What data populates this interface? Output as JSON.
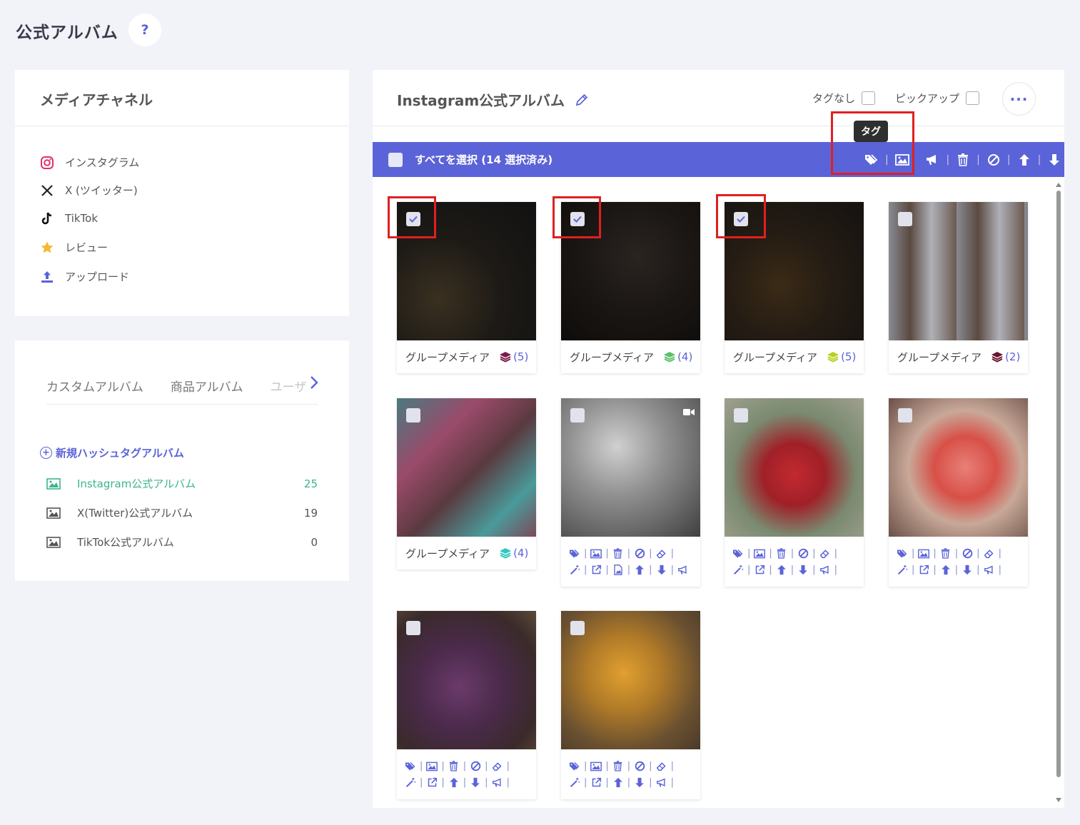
{
  "page": {
    "title": "公式アルバム",
    "help_label": "?"
  },
  "channels": {
    "title": "メディアチャネル",
    "items": [
      {
        "label": "インスタグラム",
        "icon": "instagram-icon"
      },
      {
        "label": "X (ツイッター)",
        "icon": "x-icon"
      },
      {
        "label": "TikTok",
        "icon": "tiktok-icon"
      },
      {
        "label": "レビュー",
        "icon": "star-icon"
      },
      {
        "label": "アップロード",
        "icon": "upload-icon"
      }
    ]
  },
  "albums": {
    "tabs": [
      "カスタムアルバム",
      "商品アルバム",
      "ユーザ"
    ],
    "new_album_label": "新規ハッシュタグアルバム",
    "items": [
      {
        "name": "Instagram公式アルバム",
        "count": "25",
        "active": true
      },
      {
        "name": "X(Twitter)公式アルバム",
        "count": "19",
        "active": false
      },
      {
        "name": "TikTok公式アルバム",
        "count": "0",
        "active": false
      }
    ]
  },
  "main": {
    "title": "Instagram公式アルバム",
    "filter_no_tag": "タグなし",
    "filter_pickup": "ピックアップ",
    "more_label": "···",
    "select_all_label": "すべてを選択 (14 選択済み)",
    "tooltip": "タグ"
  },
  "media": [
    {
      "checked": true,
      "caption": "グループメディア",
      "count": "(5)",
      "layer_color": "#7a1a4a",
      "video": false
    },
    {
      "checked": true,
      "caption": "グループメディア",
      "count": "(4)",
      "layer_color": "#5cbf6a",
      "video": false
    },
    {
      "checked": true,
      "caption": "グループメディア",
      "count": "(5)",
      "layer_color": "#b8d020",
      "video": false
    },
    {
      "checked": false,
      "caption": "グループメディア",
      "count": "(2)",
      "layer_color": "#6a1530",
      "video": false
    },
    {
      "checked": false,
      "caption": "グループメディア",
      "count": "(4)",
      "layer_color": "#30c8c0",
      "video": false
    },
    {
      "checked": false,
      "caption": "",
      "count": "",
      "layer_color": "",
      "video": true
    },
    {
      "checked": false,
      "caption": "",
      "count": "",
      "layer_color": "",
      "video": false
    },
    {
      "checked": false,
      "caption": "",
      "count": "",
      "layer_color": "",
      "video": false
    },
    {
      "checked": false,
      "caption": "",
      "count": "",
      "layer_color": "",
      "video": false
    },
    {
      "checked": false,
      "caption": "",
      "count": "",
      "layer_color": "",
      "video": false
    }
  ],
  "colors": {
    "accent": "#5b63d8",
    "active_album": "#3ab58a",
    "highlight": "#e02020"
  }
}
